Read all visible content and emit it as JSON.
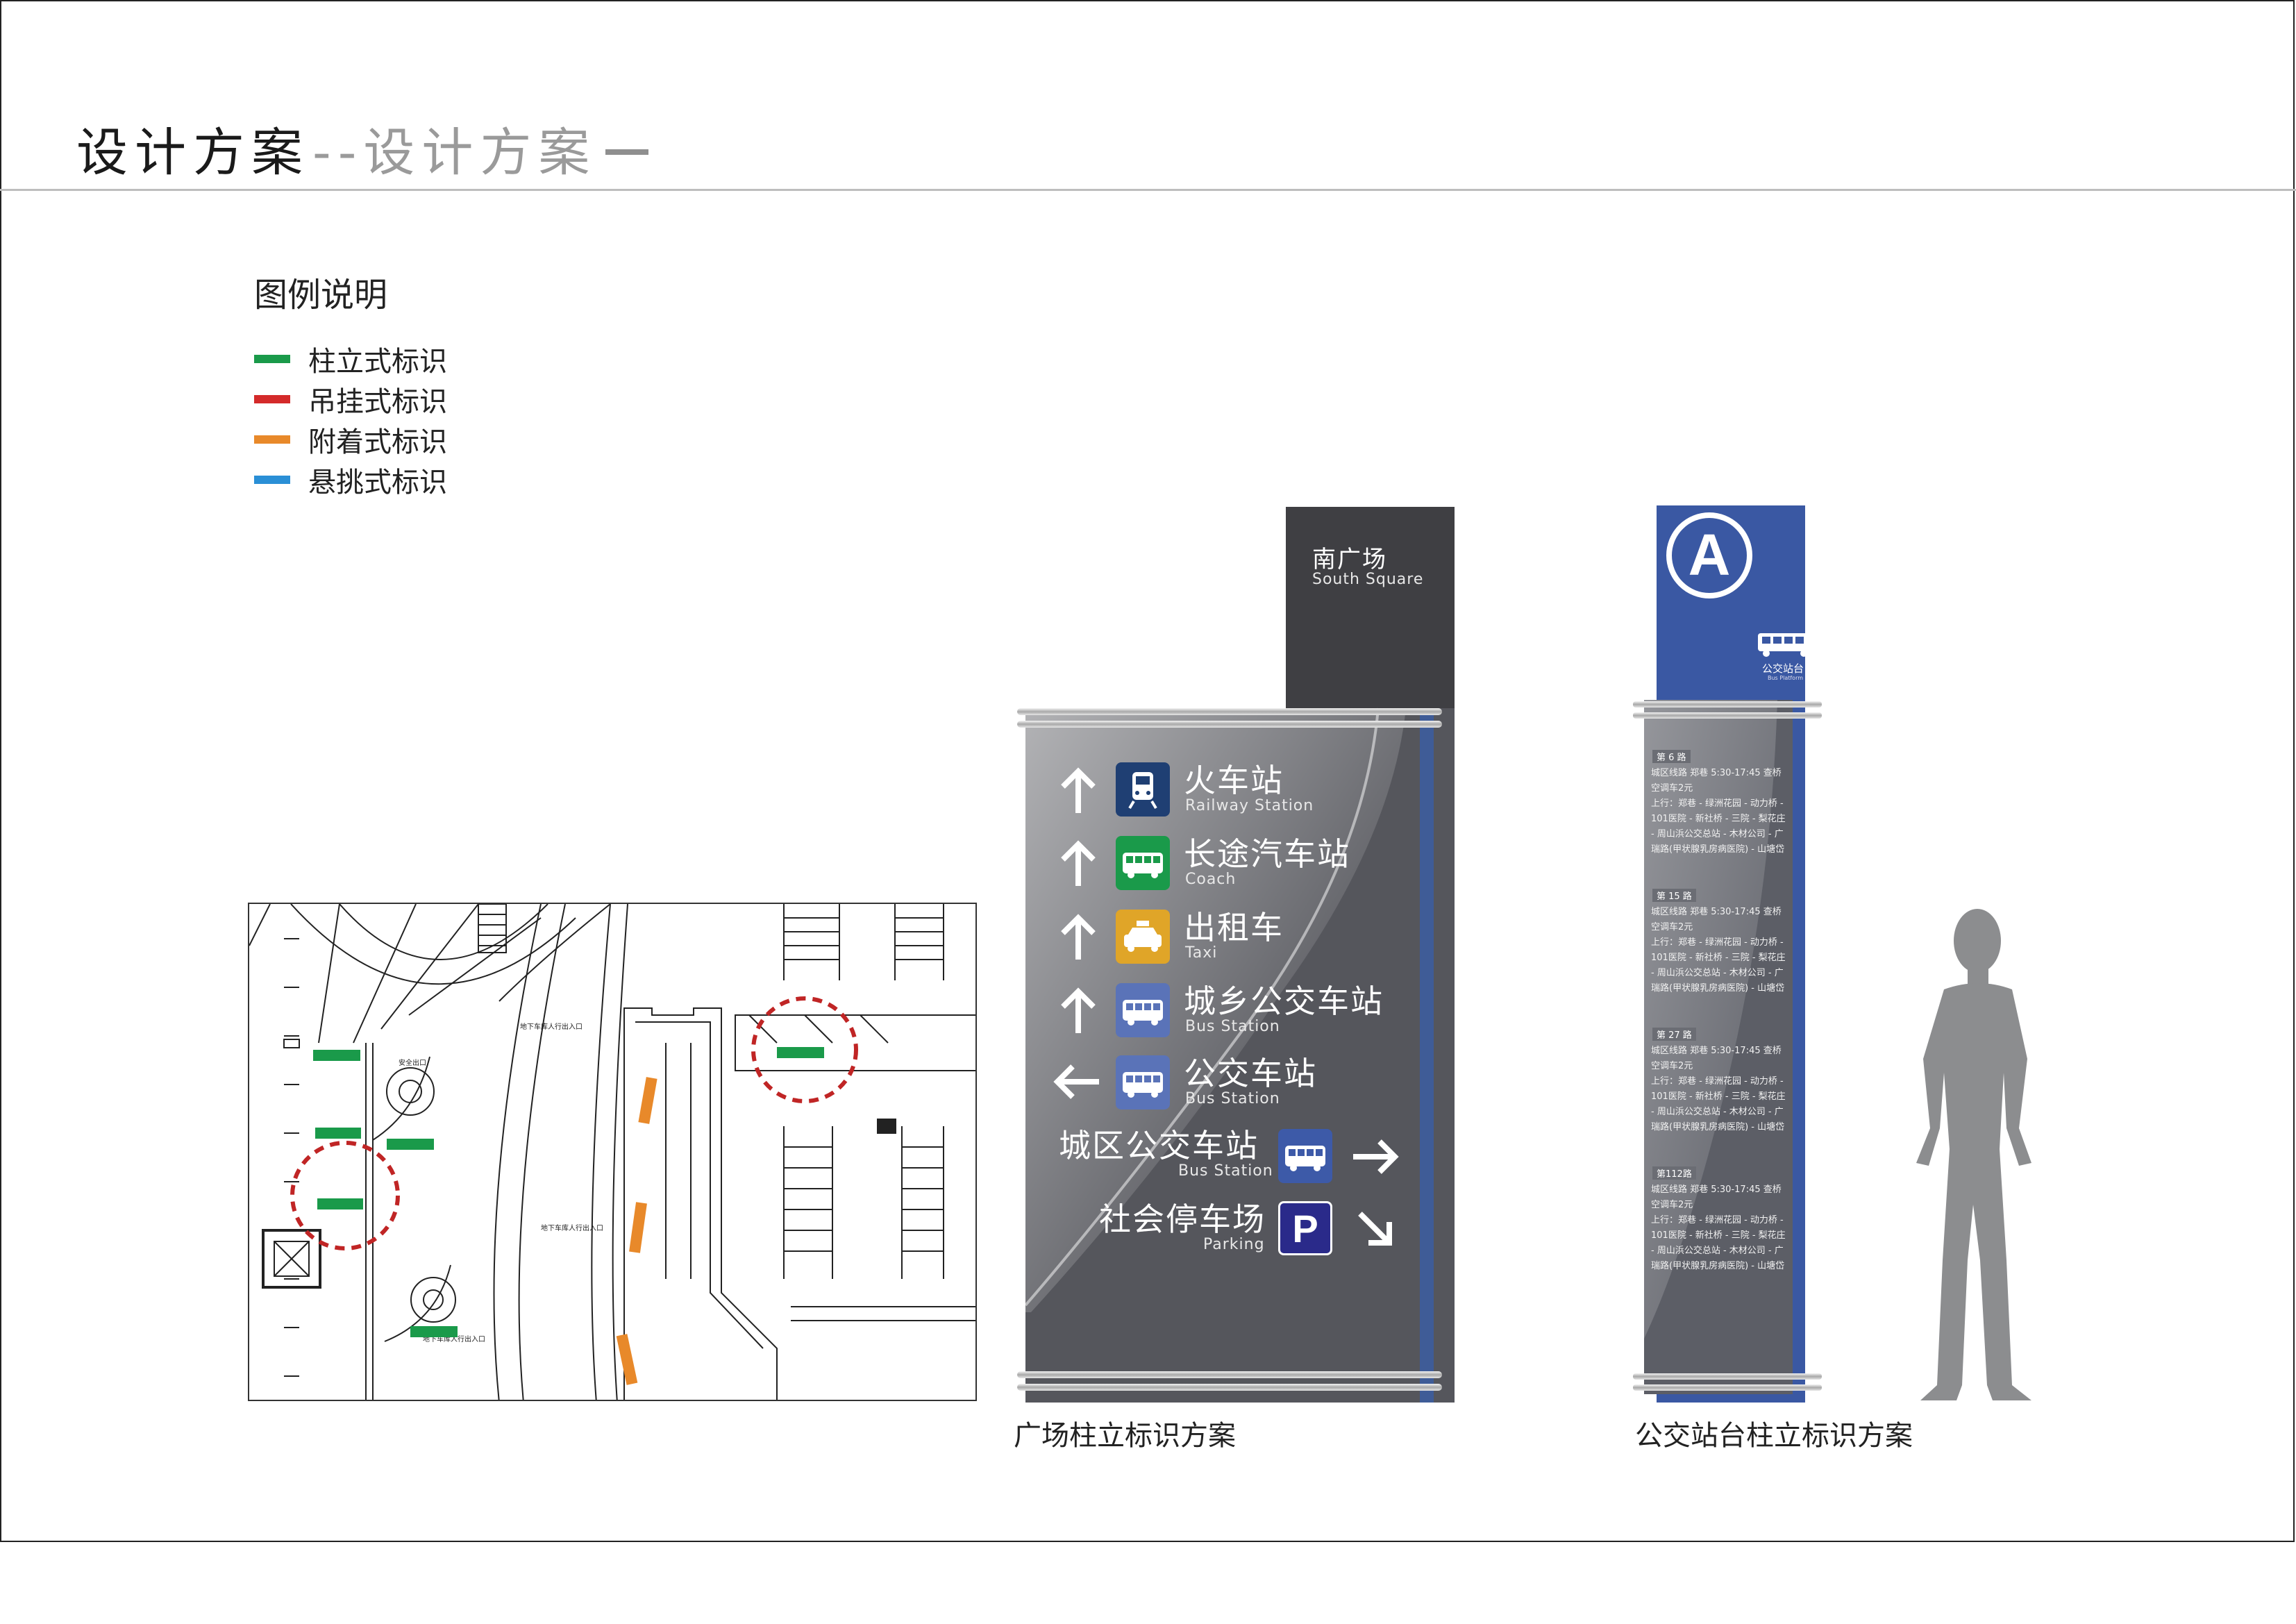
{
  "header": {
    "title": "设计方案",
    "subtitle": "--设计方案"
  },
  "legend": {
    "title": "图例说明",
    "items": [
      {
        "label": "柱立式标识",
        "color": "#1a9a4a"
      },
      {
        "label": "吊挂式标识",
        "color": "#d42a2a"
      },
      {
        "label": "附着式标识",
        "color": "#e8892a"
      },
      {
        "label": "悬挑式标识",
        "color": "#2a8fd6"
      }
    ]
  },
  "plan": {
    "labels": [
      "地下车库人行出入口",
      "安全出口",
      "地下车库人行出入口",
      "地下车库人行出入口"
    ]
  },
  "plaza_sign": {
    "caption": "广场柱立标识方案",
    "top_cn": "南广场",
    "top_en": "South Square",
    "rows": [
      {
        "cn": "火车站",
        "en": "Railway Station",
        "arrow": "up-arrow-icon",
        "icon": "train-icon",
        "icon_color": "#1f3f73"
      },
      {
        "cn": "长途汽车站",
        "en": "Coach",
        "arrow": "up-arrow-icon",
        "icon": "coach-icon",
        "icon_color": "#1a9a4a"
      },
      {
        "cn": "出租车",
        "en": "Taxi",
        "arrow": "up-arrow-icon",
        "icon": "taxi-icon",
        "icon_color": "#e0a528"
      },
      {
        "cn": "城乡公交车站",
        "en": "Bus Station",
        "arrow": "up-arrow-icon",
        "icon": "bus-icon",
        "icon_color": "#5a73b8"
      },
      {
        "cn": "公交车站",
        "en": "Bus Station",
        "arrow": "left-arrow-icon",
        "icon": "bus-icon",
        "icon_color": "#5a73b8"
      },
      {
        "cn": "城区公交车站",
        "en": "Bus Station",
        "arrow": "right-arrow-icon",
        "icon": "bus-icon",
        "icon_color": "#3d5aa8"
      },
      {
        "cn": "社会停车场",
        "en": "Parking",
        "arrow": "down-right-arrow-icon",
        "icon": "parking-icon",
        "icon_color": "#2a2a8a",
        "icon_text": "P"
      }
    ]
  },
  "bus_sign": {
    "caption": "公交站台柱立标识方案",
    "letter": "A",
    "platform_cn": "公交站台",
    "platform_en": "Bus Platform",
    "routes": [
      {
        "tag": "第 6 路",
        "lines": [
          "城区线路 郑巷 5:30-17:45 查桥",
          "空调车2元",
          "上行：郑巷 - 绿洲花园 - 动力桥 -",
          "101医院 - 新社桥 - 三院 - 梨花庄",
          "- 周山浜公交总站 - 木材公司 - 广",
          "瑞路(甲状腺乳房病医院) - 山塘岱"
        ]
      },
      {
        "tag": "第 15 路",
        "lines": [
          "城区线路 郑巷 5:30-17:45 查桥",
          "空调车2元",
          "上行：郑巷 - 绿洲花园 - 动力桥 -",
          "101医院 - 新社桥 - 三院 - 梨花庄",
          "- 周山浜公交总站 - 木材公司 - 广",
          "瑞路(甲状腺乳房病医院) - 山塘岱"
        ]
      },
      {
        "tag": "第 27 路",
        "lines": [
          "城区线路 郑巷 5:30-17:45 查桥",
          "空调车2元",
          "上行：郑巷 - 绿洲花园 - 动力桥 -",
          "101医院 - 新社桥 - 三院 - 梨花庄",
          "- 周山浜公交总站 - 木材公司 - 广",
          "瑞路(甲状腺乳房病医院) - 山塘岱"
        ]
      },
      {
        "tag": "第112路",
        "lines": [
          "城区线路 郑巷 5:30-17:45 查桥",
          "空调车2元",
          "上行：郑巷 - 绿洲花园 - 动力桥 -",
          "101医院 - 新社桥 - 三院 - 梨花庄",
          "- 周山浜公交总站 - 木材公司 - 广",
          "瑞路(甲状腺乳房病医院) - 山塘岱"
        ]
      }
    ]
  }
}
